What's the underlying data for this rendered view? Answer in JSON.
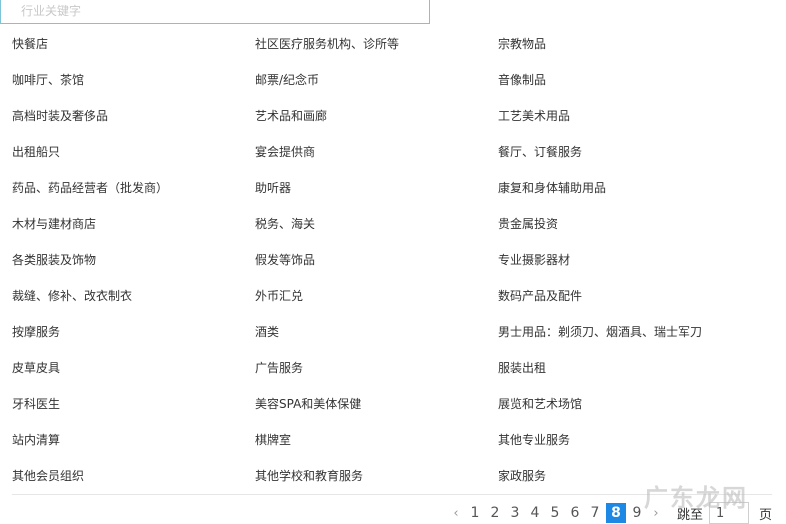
{
  "search": {
    "placeholder": "行业关键字",
    "value": ""
  },
  "categories": [
    [
      "快餐店",
      "社区医疗服务机构、诊所等",
      "宗教物品"
    ],
    [
      "咖啡厅、茶馆",
      "邮票/纪念币",
      "音像制品"
    ],
    [
      "高档时装及奢侈品",
      "艺术品和画廊",
      "工艺美术用品"
    ],
    [
      "出租船只",
      "宴会提供商",
      "餐厅、订餐服务"
    ],
    [
      "药品、药品经营者（批发商）",
      "助听器",
      "康复和身体辅助用品"
    ],
    [
      "木材与建材商店",
      "税务、海关",
      "贵金属投资"
    ],
    [
      "各类服装及饰物",
      "假发等饰品",
      "专业摄影器材"
    ],
    [
      "裁缝、修补、改衣制衣",
      "外币汇兑",
      "数码产品及配件"
    ],
    [
      "按摩服务",
      "酒类",
      "男士用品：剃须刀、烟酒具、瑞士军刀"
    ],
    [
      "皮草皮具",
      "广告服务",
      "服装出租"
    ],
    [
      "牙科医生",
      "美容SPA和美体保健",
      "展览和艺术场馆"
    ],
    [
      "站内清算",
      "棋牌室",
      "其他专业服务"
    ],
    [
      "其他会员组织",
      "其他学校和教育服务",
      "家政服务"
    ]
  ],
  "pagination": {
    "prev": "‹",
    "next": "›",
    "pages": [
      "1",
      "2",
      "3",
      "4",
      "5",
      "6",
      "7",
      "8",
      "9"
    ],
    "current": "8",
    "goto_label": "跳至",
    "goto_value": "1",
    "page_unit": "页"
  },
  "watermark": "广东龙网",
  "colors": {
    "accent": "#1e88e5",
    "search_border": "#7ec3d8"
  }
}
